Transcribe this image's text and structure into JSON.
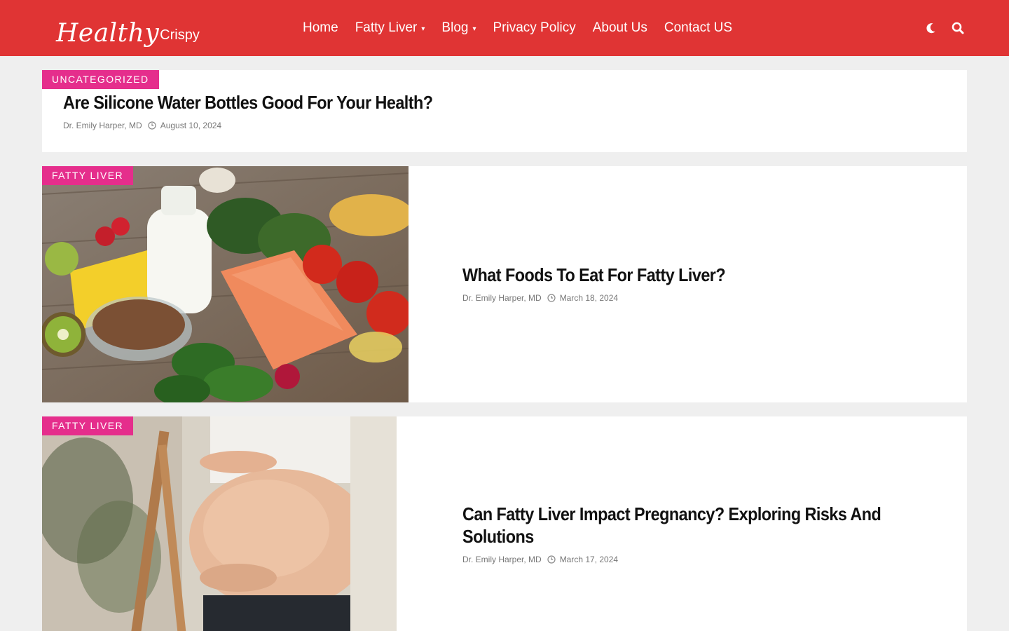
{
  "site": {
    "logo_script": "Healthy",
    "logo_sub": "Crispy"
  },
  "nav": {
    "items": [
      {
        "label": "Home",
        "has_dropdown": false
      },
      {
        "label": "Fatty Liver",
        "has_dropdown": true
      },
      {
        "label": "Blog",
        "has_dropdown": true
      },
      {
        "label": "Privacy Policy",
        "has_dropdown": false
      },
      {
        "label": "About Us",
        "has_dropdown": false
      },
      {
        "label": "Contact US",
        "has_dropdown": false
      }
    ],
    "chevron": "▾"
  },
  "icons": {
    "dark_mode": "moon-icon",
    "search": "search-icon",
    "date": "clock-icon"
  },
  "colors": {
    "header_bg": "#e03434",
    "badge_bg": "#e52e8c",
    "page_bg": "#efefef"
  },
  "posts": [
    {
      "category": "Uncategorized",
      "title": "Are Silicone Water Bottles Good For Your Health?",
      "author": "Dr. Emily Harper, MD",
      "date": "August 10, 2024"
    },
    {
      "category": "Fatty Liver",
      "title": "What Foods To Eat For Fatty Liver?",
      "author": "Dr. Emily Harper, MD",
      "date": "March 18, 2024",
      "image": "healthy-foods-photo"
    },
    {
      "category": "Fatty Liver",
      "title": "Can Fatty Liver Impact Pregnancy? Exploring Risks And Solutions",
      "author": "Dr. Emily Harper, MD",
      "date": "March 17, 2024",
      "image": "pregnant-belly-photo"
    }
  ]
}
